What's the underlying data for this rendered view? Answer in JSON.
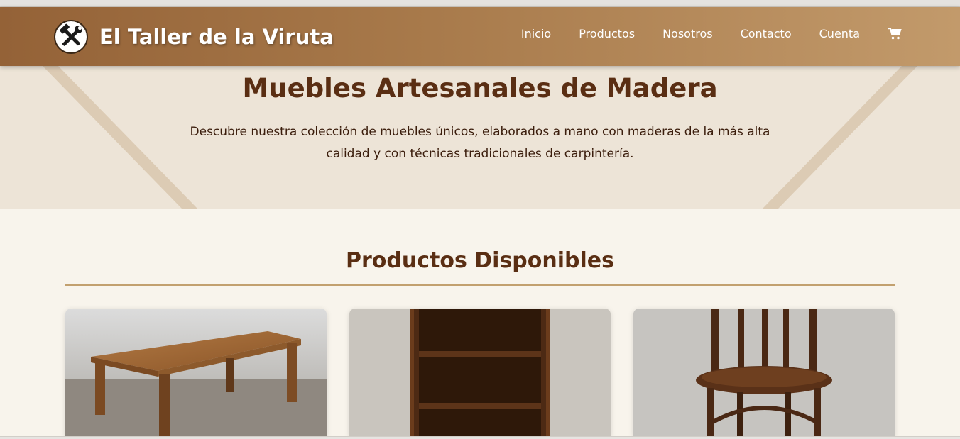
{
  "brand": {
    "name": "El Taller de la Viruta",
    "logo_icon": "hammer-wrench-icon"
  },
  "nav": {
    "items": [
      {
        "label": "Inicio"
      },
      {
        "label": "Productos"
      },
      {
        "label": "Nosotros"
      },
      {
        "label": "Contacto"
      },
      {
        "label": "Cuenta"
      }
    ],
    "cart_icon": "cart-icon"
  },
  "hero": {
    "title": "Muebles Artesanales de Madera",
    "description": "Descubre nuestra colección de muebles únicos, elaborados a mano con maderas de la más alta calidad y con técnicas tradicionales de carpintería."
  },
  "products_section": {
    "title": "Productos Disponibles",
    "products": [
      {
        "image": "wooden-table-image"
      },
      {
        "image": "wooden-bookshelf-image"
      },
      {
        "image": "wooden-chair-image"
      }
    ]
  },
  "colors": {
    "nav_start": "#946237",
    "nav_end": "#c29a6b",
    "hero_bg": "#ede4d7",
    "page_bg": "#f8f4ec",
    "heading": "#5a2e13",
    "accent_line": "#c2a06f"
  }
}
